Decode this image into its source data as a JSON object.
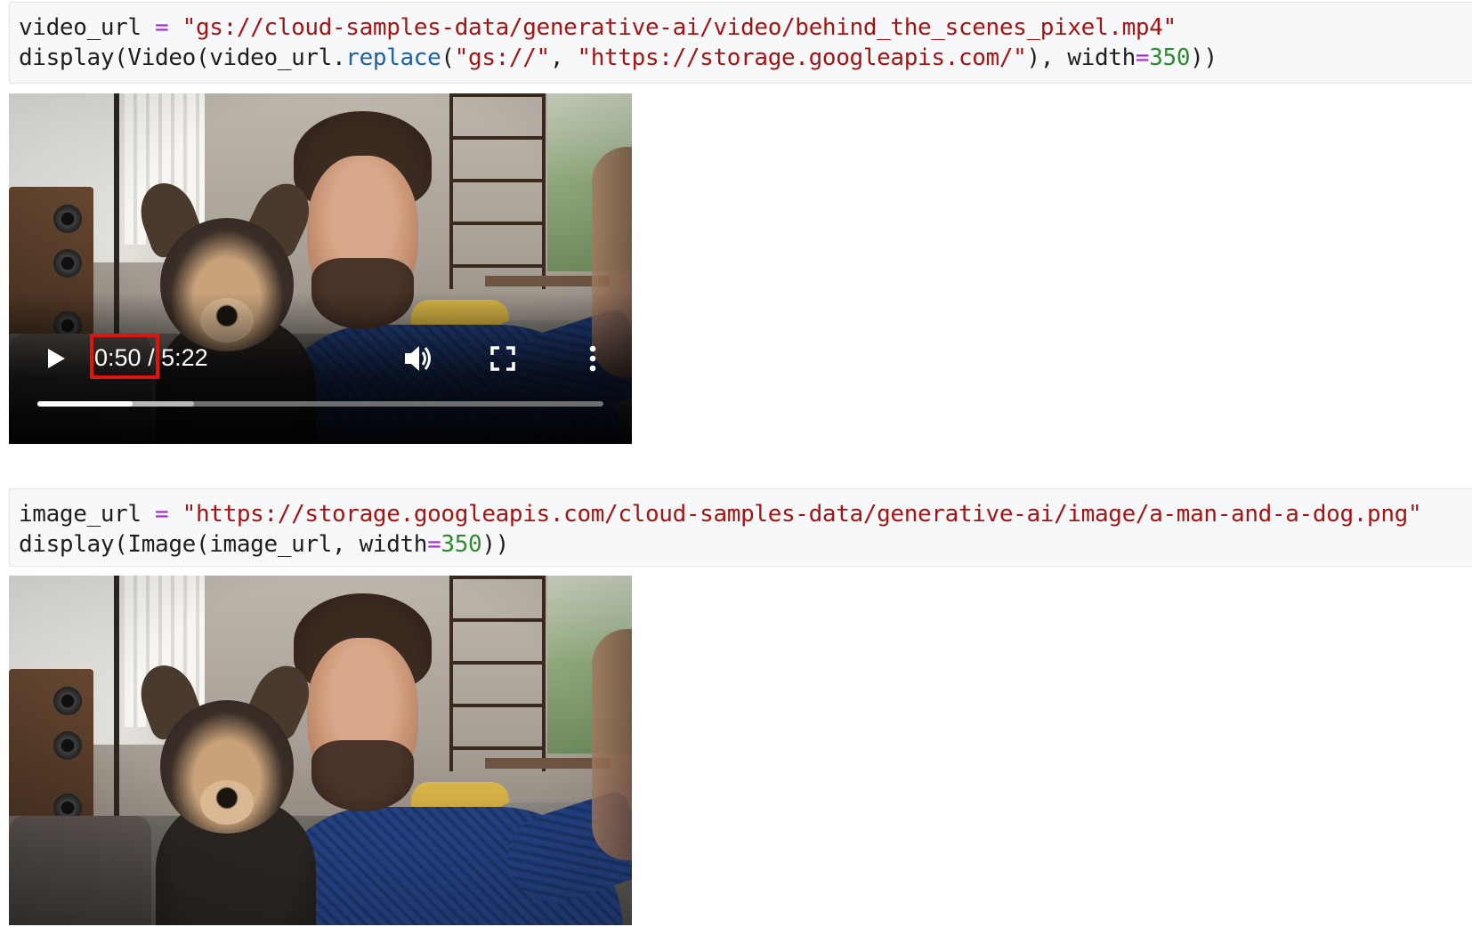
{
  "cells": [
    {
      "id": "cell-video",
      "line1": {
        "var": "video_url",
        "eq": " = ",
        "string": "\"gs://cloud-samples-data/generative-ai/video/behind_the_scenes_pixel.mp4\""
      },
      "line2": {
        "prefix": "display(Video(video_url.",
        "method": "replace",
        "open": "(",
        "str1": "\"gs://\"",
        "comma": ", ",
        "str2": "\"https://storage.googleapis.com/\"",
        "mid": "), width",
        "eq": "=",
        "num": "350",
        "close": "))"
      }
    },
    {
      "id": "cell-image",
      "line1": {
        "var": "image_url",
        "eq": " = ",
        "string": "\"https://storage.googleapis.com/cloud-samples-data/generative-ai/image/a-man-and-a-dog.png\""
      },
      "line2": {
        "prefix": "display(Image(image_url, width",
        "eq": "=",
        "num": "350",
        "close": "))"
      }
    }
  ],
  "video_player": {
    "current_time": "0:50",
    "separator": " / ",
    "duration": "5:22",
    "played_fraction": 0.169,
    "buffered_fraction": 0.276,
    "icons": {
      "play": "play-icon",
      "volume": "volume-icon",
      "fullscreen": "fullscreen-icon",
      "more": "more-options-icon"
    },
    "highlight_color": "#e0140e"
  },
  "image_output": {
    "alt": "a-man-and-a-dog"
  },
  "colors": {
    "keyword_operator": "#a626d4",
    "string": "#a31515",
    "number": "#2e8b2e",
    "method": "#1f5fa8",
    "cell_bg": "#f6f8f9"
  }
}
